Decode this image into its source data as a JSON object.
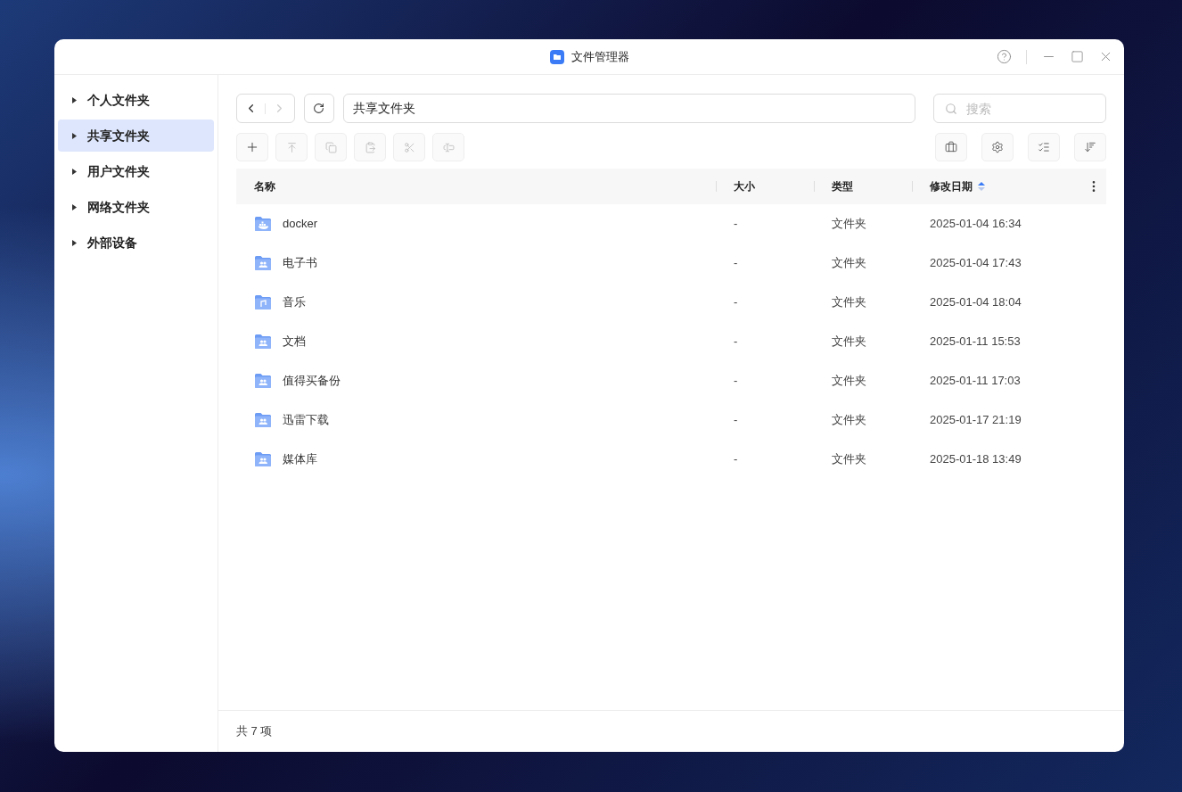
{
  "window": {
    "title": "文件管理器"
  },
  "sidebar": {
    "items": [
      {
        "label": "个人文件夹",
        "selected": false
      },
      {
        "label": "共享文件夹",
        "selected": true
      },
      {
        "label": "用户文件夹",
        "selected": false
      },
      {
        "label": "网络文件夹",
        "selected": false
      },
      {
        "label": "外部设备",
        "selected": false
      }
    ]
  },
  "nav": {
    "back_disabled": false,
    "forward_disabled": true
  },
  "path": {
    "value": "共享文件夹"
  },
  "search": {
    "placeholder": "搜索"
  },
  "toolbar": [
    {
      "disabled": false
    },
    {
      "disabled": true
    },
    {
      "disabled": true
    },
    {
      "disabled": true
    },
    {
      "disabled": true
    },
    {
      "disabled": true
    }
  ],
  "table": {
    "columns": [
      {
        "label": "名称",
        "sorted": false
      },
      {
        "label": "大小",
        "sorted": false
      },
      {
        "label": "类型",
        "sorted": false
      },
      {
        "label": "修改日期",
        "sorted": true
      }
    ],
    "rows": [
      {
        "kind": "docker",
        "name": "docker",
        "size": "-",
        "type": "文件夹",
        "modified": "2025-01-04 16:34"
      },
      {
        "kind": "shared",
        "name": "电子书",
        "size": "-",
        "type": "文件夹",
        "modified": "2025-01-04 17:43"
      },
      {
        "kind": "music",
        "name": "音乐",
        "size": "-",
        "type": "文件夹",
        "modified": "2025-01-04 18:04"
      },
      {
        "kind": "shared",
        "name": "文档",
        "size": "-",
        "type": "文件夹",
        "modified": "2025-01-11 15:53"
      },
      {
        "kind": "shared",
        "name": "值得买备份",
        "size": "-",
        "type": "文件夹",
        "modified": "2025-01-11 17:03"
      },
      {
        "kind": "shared",
        "name": "迅雷下载",
        "size": "-",
        "type": "文件夹",
        "modified": "2025-01-17 21:19"
      },
      {
        "kind": "shared",
        "name": "媒体库",
        "size": "-",
        "type": "文件夹",
        "modified": "2025-01-18 13:49"
      }
    ]
  },
  "status_bar": {
    "count": "共 7 项"
  }
}
